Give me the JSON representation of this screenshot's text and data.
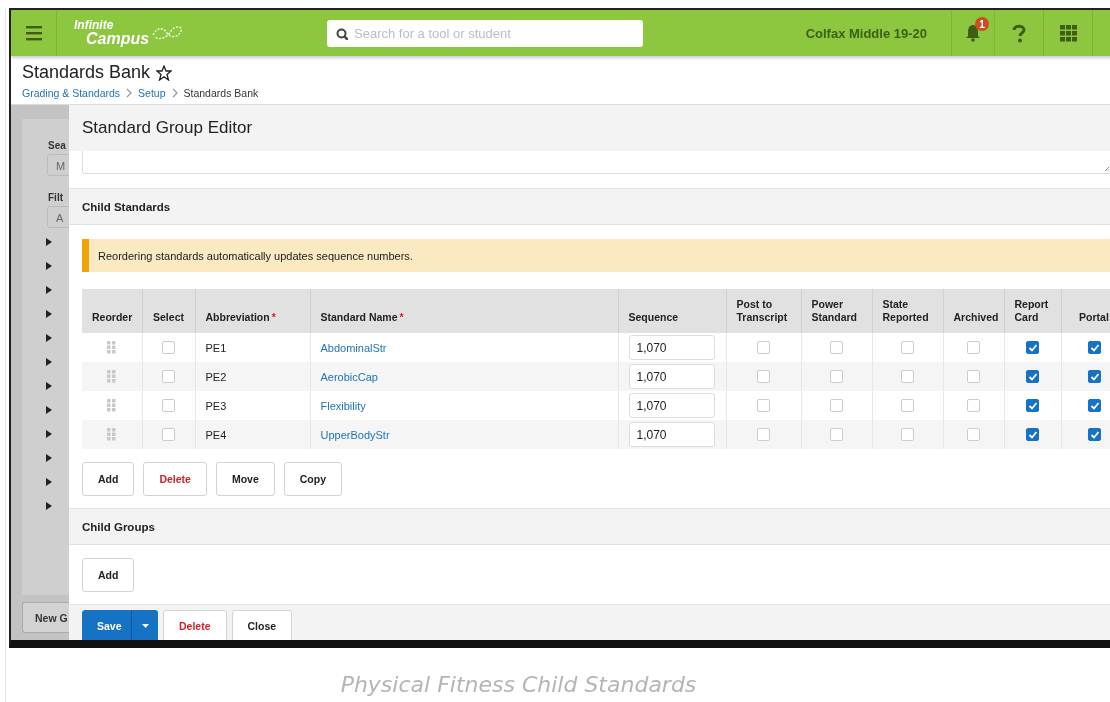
{
  "header": {
    "logo": {
      "line1": "Infinite",
      "line2": "Campus"
    },
    "search": {
      "placeholder": "Search for a tool or student"
    },
    "school": "Colfax Middle 19-20",
    "notification_count": "1"
  },
  "page": {
    "title": "Standards Bank",
    "favorite": false,
    "breadcrumb": [
      {
        "label": "Grading & Standards",
        "link": true
      },
      {
        "label": "Setup",
        "link": true
      },
      {
        "label": "Standards Bank",
        "link": false
      }
    ]
  },
  "background_panel": {
    "search_label": "Sea",
    "search_placeholder": "M",
    "filter_label": "Filt",
    "filter_placeholder": "A",
    "new_button": "New G"
  },
  "editor": {
    "title": "Standard Group Editor",
    "child_standards": {
      "heading": "Child Standards",
      "notice": "Reordering standards automatically updates sequence numbers.",
      "columns": [
        {
          "label": "Reorder",
          "kind": "handle"
        },
        {
          "label": "Select",
          "kind": "select"
        },
        {
          "label": "Abbreviation",
          "kind": "text",
          "required_mark": "*"
        },
        {
          "label": "Standard Name",
          "kind": "link",
          "required_mark": "*"
        },
        {
          "label": "Sequence",
          "kind": "input"
        },
        {
          "label": "Post to Transcript",
          "kind": "check"
        },
        {
          "label": "Power Standard",
          "kind": "check"
        },
        {
          "label": "State Reported",
          "kind": "check"
        },
        {
          "label": "Archived",
          "kind": "check"
        },
        {
          "label": "Report Card",
          "kind": "check"
        },
        {
          "label": "Portal",
          "kind": "check"
        }
      ],
      "rows": [
        {
          "abbreviation": "PE1",
          "name": "AbdominalStr",
          "sequence": "1,070",
          "select": false,
          "checks": [
            false,
            false,
            false,
            false,
            true,
            true
          ]
        },
        {
          "abbreviation": "PE2",
          "name": "AerobicCap",
          "sequence": "1,070",
          "select": false,
          "checks": [
            false,
            false,
            false,
            false,
            true,
            true
          ]
        },
        {
          "abbreviation": "PE3",
          "name": "Flexibility",
          "sequence": "1,070",
          "select": false,
          "checks": [
            false,
            false,
            false,
            false,
            true,
            true
          ]
        },
        {
          "abbreviation": "PE4",
          "name": "UpperBodyStr",
          "sequence": "1,070",
          "select": false,
          "checks": [
            false,
            false,
            false,
            false,
            true,
            true
          ]
        }
      ],
      "buttons": [
        {
          "label": "Add",
          "kind": "plain"
        },
        {
          "label": "Delete",
          "kind": "danger"
        },
        {
          "label": "Move",
          "kind": "plain"
        },
        {
          "label": "Copy",
          "kind": "plain"
        }
      ]
    },
    "child_groups": {
      "heading": "Child Groups",
      "buttons": [
        {
          "label": "Add",
          "kind": "plain"
        }
      ]
    },
    "footer": [
      {
        "label": "Save",
        "kind": "primary"
      },
      {
        "label": "Delete",
        "kind": "danger"
      },
      {
        "label": "Close",
        "kind": "plain"
      }
    ]
  },
  "caption": "Physical Fitness Child Standards"
}
